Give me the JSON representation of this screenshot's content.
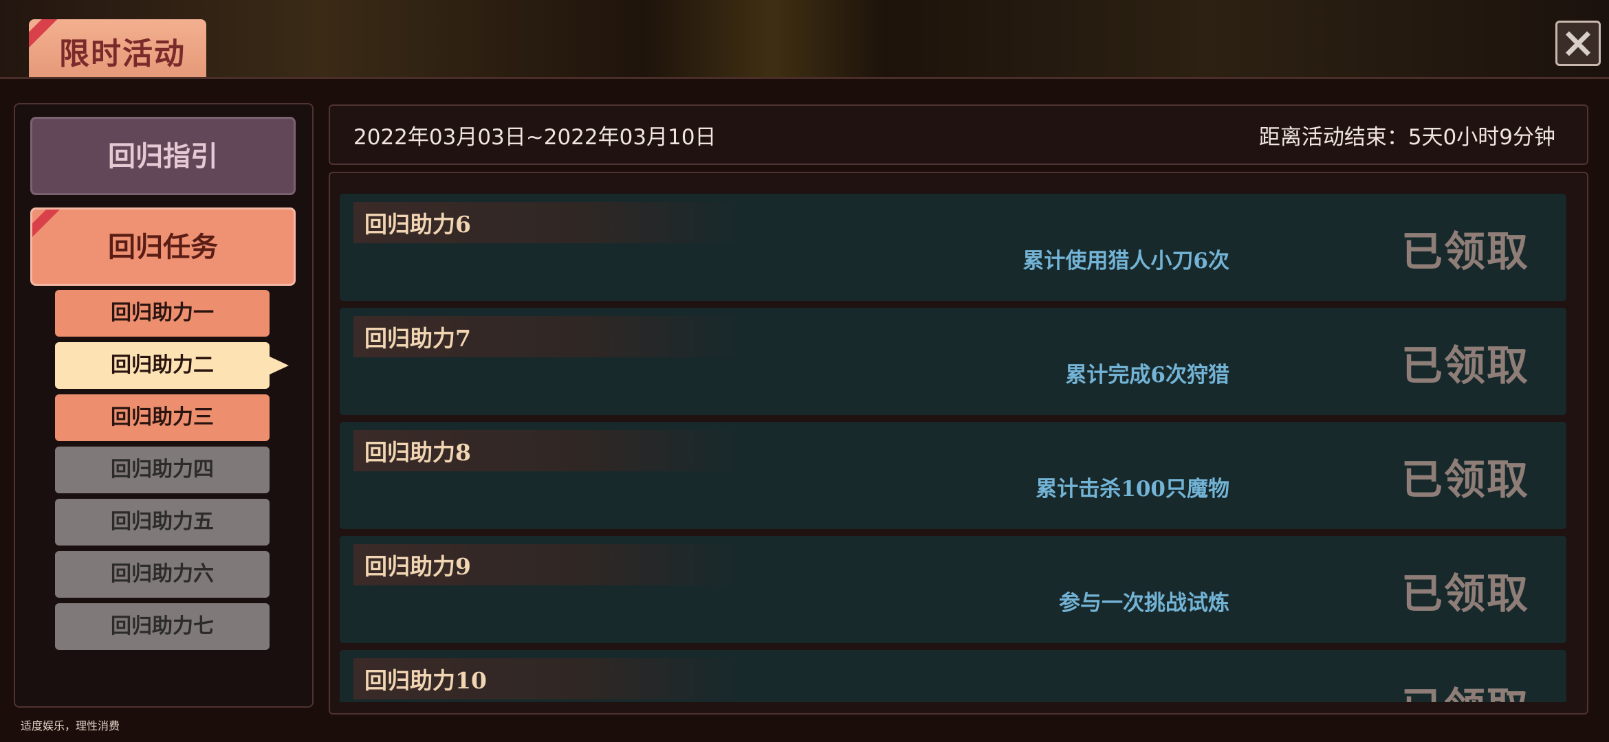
{
  "window": {
    "title": "限时活动",
    "close_icon": "close-x-icon"
  },
  "sidebar": {
    "main_buttons": [
      {
        "label": "回归指引",
        "state": "normal"
      },
      {
        "label": "回归任务",
        "state": "selected"
      }
    ],
    "sub_items": [
      {
        "label": "回归助力一",
        "state": "orange"
      },
      {
        "label": "回归助力二",
        "state": "active"
      },
      {
        "label": "回归助力三",
        "state": "orange"
      },
      {
        "label": "回归助力四",
        "state": "locked"
      },
      {
        "label": "回归助力五",
        "state": "locked"
      },
      {
        "label": "回归助力六",
        "state": "locked"
      },
      {
        "label": "回归助力七",
        "state": "locked"
      }
    ]
  },
  "header": {
    "date_range": "2022年03月03日~2022年03月10日",
    "countdown": "距离活动结束：5天0小时9分钟"
  },
  "tasks": [
    {
      "name": "回归助力6",
      "desc": "累计使用猎人小刀6次",
      "status": "已领取"
    },
    {
      "name": "回归助力7",
      "desc": "累计完成6次狩猎",
      "status": "已领取"
    },
    {
      "name": "回归助力8",
      "desc": "累计击杀100只魔物",
      "status": "已领取"
    },
    {
      "name": "回归助力9",
      "desc": "参与一次挑战试炼",
      "status": "已领取"
    },
    {
      "name": "回归助力10",
      "desc": "",
      "status": "已领取"
    }
  ],
  "footer": {
    "note": "适度娱乐，理性消费"
  },
  "colors": {
    "accent_orange": "#ef9274",
    "active_item": "#fde3b3",
    "card_bg": "#18292c",
    "desc_blue": "#73b4d6"
  }
}
